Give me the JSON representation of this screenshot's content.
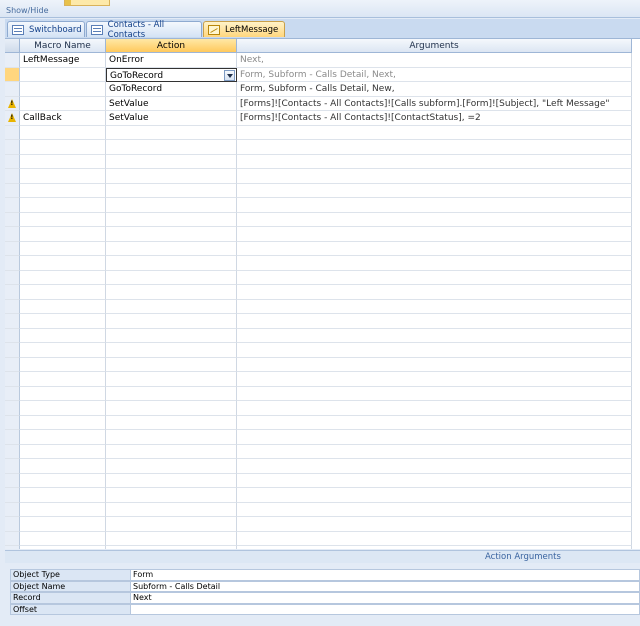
{
  "ribbon": {
    "group_label": "Show/Hide"
  },
  "tabs": [
    {
      "label": "Switchboard",
      "icon": "form-icon"
    },
    {
      "label": "Contacts - All Contacts",
      "icon": "form-icon"
    },
    {
      "label": "LeftMessage",
      "icon": "macro-icon",
      "active": true
    }
  ],
  "grid": {
    "columns": {
      "macro_name": "Macro Name",
      "action": "Action",
      "arguments": "Arguments"
    },
    "rows": [
      {
        "warning": false,
        "macro_name": "LeftMessage",
        "action": "OnError",
        "arguments": "Next,"
      },
      {
        "warning": false,
        "macro_name": "",
        "action": "GoToRecord",
        "arguments": "Form, Subform - Calls Detail, Next,",
        "current": true
      },
      {
        "warning": false,
        "macro_name": "",
        "action": "GoToRecord",
        "arguments": "Form, Subform - Calls Detail, New,"
      },
      {
        "warning": true,
        "macro_name": "",
        "action": "SetValue",
        "arguments": "[Forms]![Contacts - All Contacts]![Calls subform].[Form]![Subject], \"Left Message\""
      },
      {
        "warning": true,
        "macro_name": "CallBack",
        "action": "SetValue",
        "arguments": "[Forms]![Contacts - All Contacts]![ContactStatus], =2"
      }
    ],
    "empty_rows": 30
  },
  "action_arguments": {
    "title": "Action Arguments",
    "properties": [
      {
        "label": "Object Type",
        "value": "Form"
      },
      {
        "label": "Object Name",
        "value": "Subform - Calls Detail"
      },
      {
        "label": "Record",
        "value": "Next"
      },
      {
        "label": "Offset",
        "value": ""
      }
    ]
  }
}
